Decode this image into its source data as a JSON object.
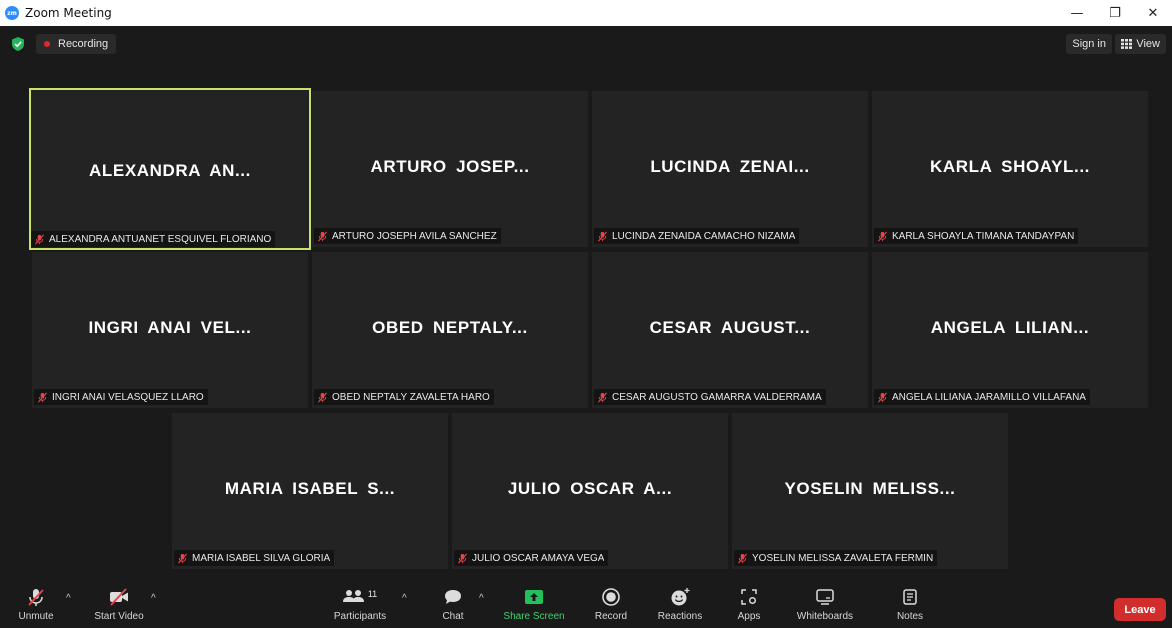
{
  "window": {
    "logo_text": "zm",
    "title": "Zoom Meeting",
    "minimize": "—",
    "restore": "❐",
    "close": "✕"
  },
  "topbar": {
    "recording_label": "Recording",
    "sign_in_label": "Sign in",
    "view_label": "View"
  },
  "participants": [
    {
      "display": "ALEXANDRA AN...",
      "full_name": "ALEXANDRA ANTUANET ESQUIVEL FLORIANO",
      "active_speaker": true
    },
    {
      "display": "ARTURO JOSEP...",
      "full_name": "ARTURO JOSEPH AVILA SANCHEZ"
    },
    {
      "display": "LUCINDA ZENAI...",
      "full_name": "LUCINDA ZENAIDA CAMACHO NIZAMA"
    },
    {
      "display": "KARLA SHOAYL...",
      "full_name": "KARLA SHOAYLA TIMANA TANDAYPAN"
    },
    {
      "display": "INGRI ANAI VEL...",
      "full_name": "INGRI ANAI VELASQUEZ LLARO"
    },
    {
      "display": "OBED NEPTALY...",
      "full_name": "OBED NEPTALY ZAVALETA HARO"
    },
    {
      "display": "CESAR AUGUST...",
      "full_name": "CESAR AUGUSTO GAMARRA VALDERRAMA"
    },
    {
      "display": "ANGELA LILIAN...",
      "full_name": "ANGELA LILIANA JARAMILLO VILLAFANA"
    },
    {
      "display": "MARIA ISABEL S...",
      "full_name": "MARIA ISABEL SILVA GLORIA"
    },
    {
      "display": "JULIO OSCAR A...",
      "full_name": "JULIO OSCAR AMAYA VEGA"
    },
    {
      "display": "YOSELIN MELISS...",
      "full_name": "YOSELIN MELISSA ZAVALETA FERMIN"
    }
  ],
  "toolbar": {
    "unmute_label": "Unmute",
    "start_video_label": "Start Video",
    "participants_label": "Participants",
    "participants_count": "11",
    "chat_label": "Chat",
    "share_screen_label": "Share Screen",
    "record_label": "Record",
    "reactions_label": "Reactions",
    "apps_label": "Apps",
    "whiteboards_label": "Whiteboards",
    "notes_label": "Notes",
    "leave_label": "Leave",
    "caret": "^"
  },
  "colors": {
    "background": "#1a1a1a",
    "tile": "#232323",
    "active_speaker_border": "#c8e36a",
    "recording_dot": "#e02828",
    "share_screen": "#3fd26f",
    "leave": "#d22d2d",
    "muted_icon": "#e0454a"
  },
  "icons": {
    "unmute": "muted-microphone-icon",
    "start_video": "video-off-icon",
    "participants": "participants-icon",
    "chat": "chat-bubble-icon",
    "share_screen": "share-screen-arrow-icon",
    "record": "record-icon",
    "reactions": "reactions-smiley-icon",
    "apps": "apps-icon",
    "whiteboards": "whiteboard-icon",
    "notes": "notes-icon",
    "encryption": "shield-check-icon",
    "view": "grid-view-icon"
  }
}
